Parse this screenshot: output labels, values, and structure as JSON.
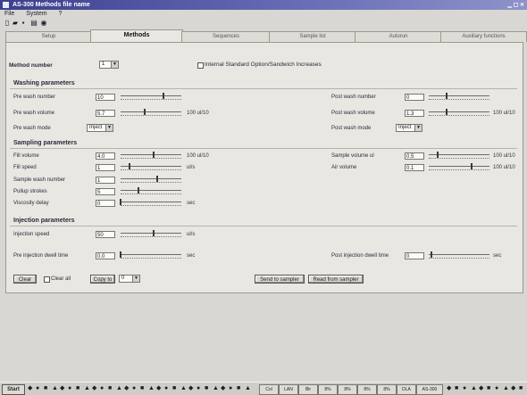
{
  "window": {
    "title": "AS-300 Methods file name"
  },
  "menu": [
    "File",
    "System",
    "?"
  ],
  "tabs": [
    "Setup",
    "Methods",
    "Sequences",
    "Sample list",
    "Autorun",
    "Auxiliary functions"
  ],
  "method": {
    "number_label": "Method number",
    "number_value": "1",
    "internal_standard_label": "Internal Standard Option/Sandwich Increases"
  },
  "washing": {
    "title": "Washing parameters",
    "pre_number_label": "Pre wash number",
    "pre_number_value": "10",
    "pre_volume_label": "Pre wash volume",
    "pre_volume_value": "5.7",
    "pre_volume_unit": "100 ul/10",
    "pre_mode_label": "Pre wash mode",
    "pre_mode_value": "Inject",
    "post_number_label": "Post wash number",
    "post_number_value": "0",
    "post_volume_label": "Post wash volume",
    "post_volume_value": "1.3",
    "post_volume_unit": "100 ul/10",
    "post_mode_label": "Post wash mode",
    "post_mode_value": "Inject"
  },
  "sampling": {
    "title": "Sampling parameters",
    "fill_volume_label": "Fill volume",
    "fill_volume_value": "4.0",
    "fill_volume_unit": "100 ul/10",
    "fill_speed_label": "Fill speed",
    "fill_speed_value": "1",
    "fill_speed_unit": "ul/s",
    "sample_wash_label": "Sample wash number",
    "sample_wash_value": "1",
    "pullup_label": "Pullup strokes",
    "pullup_value": "5",
    "viscosity_label": "Viscosity delay",
    "viscosity_value": "0",
    "viscosity_unit": "sec",
    "sample_volume_label": "Sample volume ul",
    "sample_volume_value": "0.5",
    "sample_volume_unit": "100 ul/10",
    "air_volume_label": "Air volume",
    "air_volume_value": "0.1",
    "air_volume_unit": "100 ul/10"
  },
  "injection": {
    "title": "Injection parameters",
    "speed_label": "Injection speed",
    "speed_value": "50",
    "speed_unit": "ul/s",
    "pre_dwell_label": "Pre injection dwell time",
    "pre_dwell_value": "0.0",
    "pre_dwell_unit": "sec",
    "post_dwell_label": "Post injection dwell time",
    "post_dwell_value": "0",
    "post_dwell_unit": "sec"
  },
  "buttons": {
    "clear": "Clear",
    "clear_all": "Clear all",
    "copy_to": "Copy to",
    "copy_to_value": "0",
    "send_to_sampler": "Send to sampler",
    "read_from_sampler": "Read from sampler"
  },
  "sliders": {
    "pre_number": 0.7,
    "pre_volume": 0.4,
    "post_number": 0.3,
    "post_volume": 0.3,
    "fill_volume": 0.55,
    "fill_speed": 0.15,
    "sample_wash": 0.6,
    "pullup": 0.3,
    "viscosity": 0.0,
    "sample_volume": 0.15,
    "air_volume": 0.7,
    "inj_speed": 0.55,
    "pre_dwell": 0.0,
    "post_dwell": 0.05
  },
  "taskbar": {
    "start": "Start",
    "items": [
      "Col",
      "LAN",
      "Blr",
      "8%",
      "8%",
      "8%",
      "8%",
      "DLA",
      "AS-300"
    ]
  }
}
